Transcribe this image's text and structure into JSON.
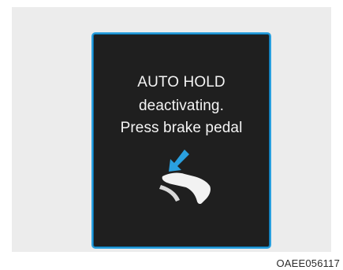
{
  "cluster_message": {
    "line1": "AUTO HOLD",
    "line2": "deactivating.",
    "line3": "Press brake pedal"
  },
  "icons": {
    "arrow": "arrow-down-left-icon",
    "pedal": "brake-pedal-icon"
  },
  "colors": {
    "screen_background": "#1f1f1f",
    "screen_border": "#2aa0df",
    "arrow": "#2aa0df",
    "text": "#f4f4f4",
    "panel_background": "#ececec"
  },
  "figure_code": "OAEE056117"
}
